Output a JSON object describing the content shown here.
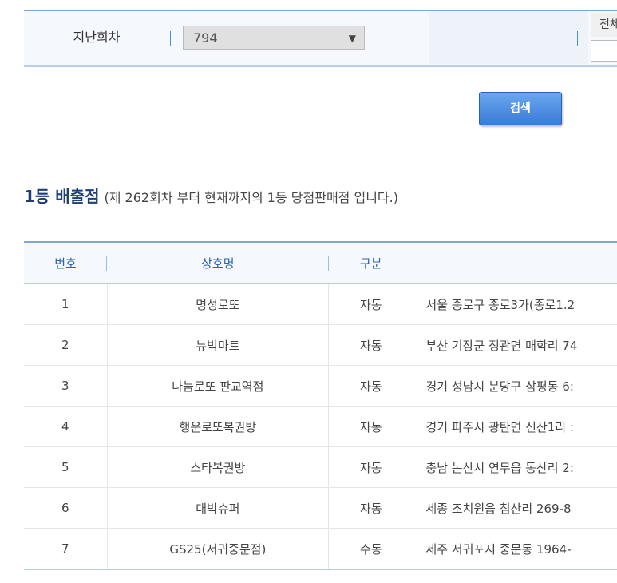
{
  "search": {
    "round_label": "지난회차",
    "round_value": "794",
    "right_label": "전체"
  },
  "search_button": "검색",
  "title": {
    "main": "1등 배출점",
    "sub": "(제 262회차 부터 현재까지의 1등 당첨판매점 입니다.)"
  },
  "table": {
    "headers": [
      "번호",
      "상호명",
      "구분",
      ""
    ],
    "rows": [
      {
        "no": "1",
        "name": "명성로또",
        "type": "자동",
        "addr": "서울 종로구 종로3가(종로1.2"
      },
      {
        "no": "2",
        "name": "뉴빅마트",
        "type": "자동",
        "addr": "부산 기장군 정관면 매학리 74"
      },
      {
        "no": "3",
        "name": "나눔로또 판교역점",
        "type": "자동",
        "addr": "경기 성남시 분당구 삼평동 6:"
      },
      {
        "no": "4",
        "name": "행운로또복권방",
        "type": "자동",
        "addr": "경기 파주시 광탄면 신산1리 :"
      },
      {
        "no": "5",
        "name": "스타복권방",
        "type": "자동",
        "addr": "충남 논산시 연무읍 동산리 2:"
      },
      {
        "no": "6",
        "name": "대박슈퍼",
        "type": "자동",
        "addr": "세종 조치원읍 침산리 269-8"
      },
      {
        "no": "7",
        "name": "GS25(서귀중문점)",
        "type": "수동",
        "addr": "제주 서귀포시 중문동 1964-"
      }
    ]
  },
  "colors": {
    "accent": "#2b63b8",
    "title": "#1b3f78",
    "button": "#3b7ad8"
  }
}
